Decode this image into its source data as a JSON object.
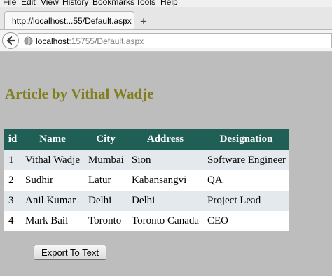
{
  "menu": {
    "items": [
      {
        "label": "File"
      },
      {
        "label": "Edit"
      },
      {
        "label": "View"
      },
      {
        "label": "History"
      },
      {
        "label": "Bookmarks"
      },
      {
        "label": "Tools"
      },
      {
        "label": "Help"
      }
    ]
  },
  "tab": {
    "title": "http://localhost...55/Default.aspx",
    "close_glyph": "×"
  },
  "new_tab_glyph": "+",
  "address": {
    "host": "localhost",
    "rest": ":15755/Default.aspx"
  },
  "page": {
    "heading": "Article by Vithal Wadje",
    "table": {
      "headers": [
        "id",
        "Name",
        "City",
        "Address",
        "Designation"
      ],
      "rows": [
        [
          "1",
          "Vithal Wadje",
          "Mumbai",
          "Sion",
          "Software Engineer"
        ],
        [
          "2",
          "Sudhir",
          "Latur",
          "Kabansangvi",
          "QA"
        ],
        [
          "3",
          "Anil Kumar",
          "Delhi",
          "Delhi",
          "Project Lead"
        ],
        [
          "4",
          "Mark Bail",
          "Toronto",
          "Toronto Canada",
          "CEO"
        ]
      ]
    },
    "export_button": "Export To Text"
  },
  "colors": {
    "page_bg": "#bdbdbd",
    "heading": "#807e1d",
    "header_bg": "#1f5f55",
    "odd_row": "#e3e9ed",
    "even_row": "#ffffff"
  }
}
